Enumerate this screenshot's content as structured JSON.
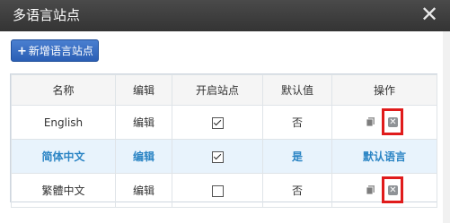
{
  "dialog": {
    "title": "多语言站点",
    "close_glyph": "✕"
  },
  "toolbar": {
    "add_label": "新增语言站点",
    "add_icon": "plus-icon"
  },
  "table": {
    "headers": [
      "名称",
      "编辑",
      "开启站点",
      "默认值",
      "操作"
    ],
    "rows": [
      {
        "name": "English",
        "edit": "编辑",
        "enabled": true,
        "default": "否",
        "ops": "icons"
      },
      {
        "name": "简体中文",
        "edit": "编辑",
        "enabled": true,
        "default": "是",
        "ops": "默认语言"
      },
      {
        "name": "繁體中文",
        "edit": "编辑",
        "enabled": false,
        "default": "否",
        "ops": "icons"
      }
    ]
  },
  "colors": {
    "title_bar": "#3c3c3c",
    "accent_blue": "#2a84c4",
    "button_blue": "#2b5fb5",
    "highlight_red": "#e01b1b",
    "default_row_bg": "#e8f3fc"
  }
}
